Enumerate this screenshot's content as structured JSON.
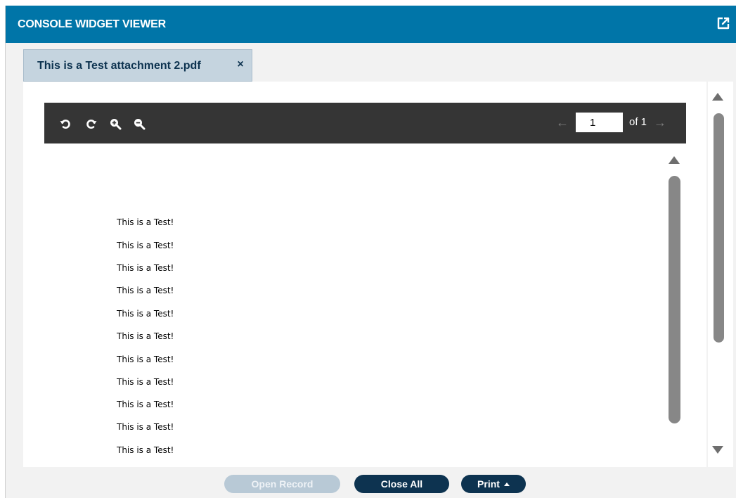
{
  "window": {
    "title": "CONSOLE WIDGET VIEWER",
    "accent_color": "#0075a8",
    "popout_icon": "external-link-icon"
  },
  "tabs": [
    {
      "label": "This is a Test attachment 2.pdf",
      "close_symbol": "×",
      "active": true
    }
  ],
  "pdf_viewer": {
    "toolbar": {
      "icons": [
        "rotate-left-icon",
        "rotate-right-icon",
        "zoom-in-icon",
        "zoom-out-icon"
      ],
      "prev_arrow": "←",
      "next_arrow": "→",
      "current_page": "1",
      "page_of": "of 1"
    },
    "document_lines": [
      "This is a Test!",
      "This is a Test!",
      "This is a Test!",
      "This is a Test!",
      "This is a Test!",
      "This is a Test!",
      "This is a Test!",
      "This is a Test!",
      "This is a Test!",
      "This is a Test!",
      "This is a Test!"
    ]
  },
  "footer": {
    "open_record_label": "Open Record",
    "close_all_label": "Close All",
    "print_label": "Print",
    "button_color": "#0d3350",
    "disabled_button_color": "#b8c9d6"
  }
}
